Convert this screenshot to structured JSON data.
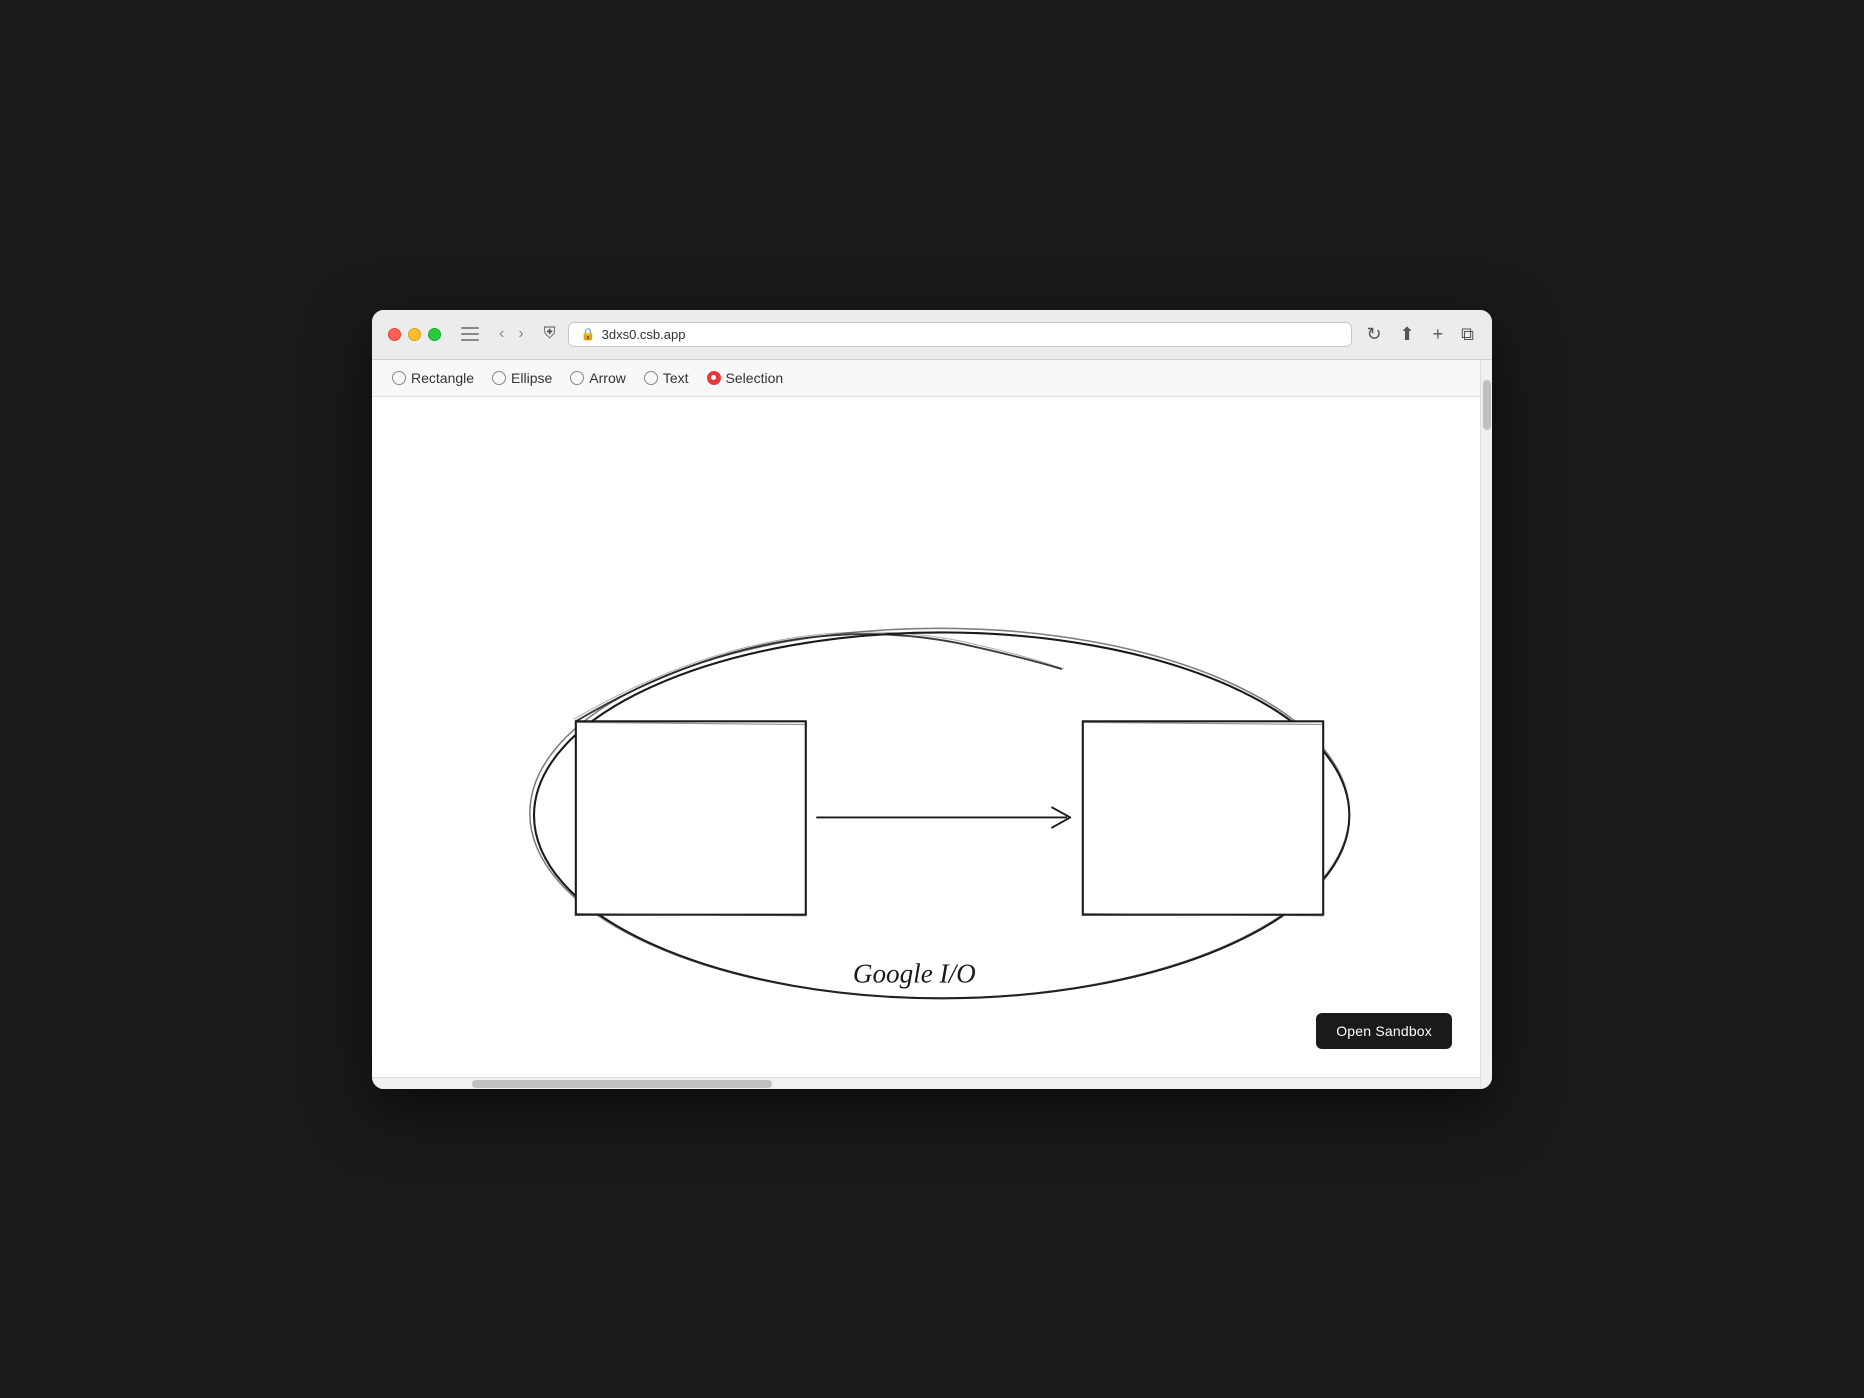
{
  "browser": {
    "url": "3dxs0.csb.app",
    "url_display": "🔒 3dxs0.csb.app"
  },
  "toolbar": {
    "tools": [
      {
        "id": "rectangle",
        "label": "Rectangle",
        "selected": false
      },
      {
        "id": "ellipse",
        "label": "Ellipse",
        "selected": false
      },
      {
        "id": "arrow",
        "label": "Arrow",
        "selected": false
      },
      {
        "id": "text",
        "label": "Text",
        "selected": false
      },
      {
        "id": "selection",
        "label": "Selection",
        "selected": true
      }
    ]
  },
  "canvas": {
    "open_sandbox_label": "Open Sandbox"
  },
  "colors": {
    "selection_dot": "#e53935",
    "dark_btn": "#1a1a1a"
  }
}
